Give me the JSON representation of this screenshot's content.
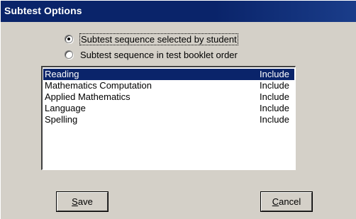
{
  "window": {
    "title": "Subtest Options"
  },
  "options": {
    "student_selected": {
      "label": "Subtest sequence selected by student",
      "checked": true
    },
    "booklet_order": {
      "label": "Subtest sequence in test booklet order",
      "checked": false
    }
  },
  "subtests": [
    {
      "name": "Reading",
      "status": "Include",
      "selected": true
    },
    {
      "name": "Mathematics Computation",
      "status": "Include",
      "selected": false
    },
    {
      "name": "Applied Mathematics",
      "status": "Include",
      "selected": false
    },
    {
      "name": "Language",
      "status": "Include",
      "selected": false
    },
    {
      "name": "Spelling",
      "status": "Include",
      "selected": false
    }
  ],
  "buttons": {
    "save": {
      "accel": "S",
      "rest": "ave"
    },
    "cancel": {
      "accel": "C",
      "rest": "ancel"
    }
  },
  "colors": {
    "titlebar": "#0a246a",
    "face": "#d4d0c8",
    "selection": "#0a246a"
  }
}
